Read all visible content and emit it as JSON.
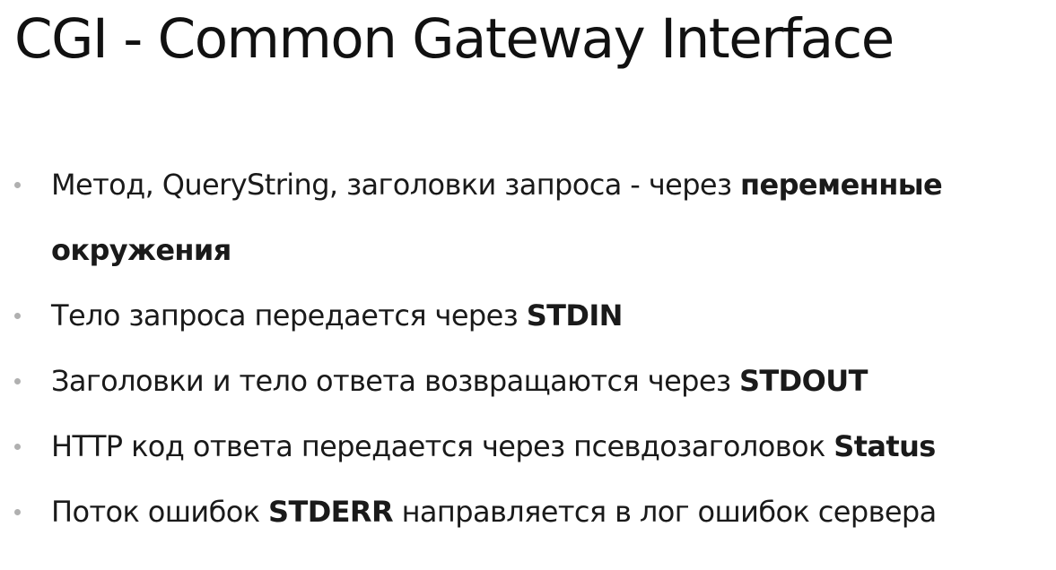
{
  "slide": {
    "title": "CGI - Common Gateway Interface",
    "bullets": [
      {
        "text": "Метод, QueryString, заголовки запроса - через ",
        "bold": "переменные",
        "continuation_bold": "окружения"
      },
      {
        "text": "Тело запроса передается через ",
        "bold": "STDIN"
      },
      {
        "text": "Заголовки и тело ответа возвращаются через ",
        "bold": "STDOUT"
      },
      {
        "text": "HTTP код ответа передается через псевдозаголовок ",
        "bold": "Status"
      },
      {
        "text_before": "Поток ошибок ",
        "bold": "STDERR",
        "text_after": " направляется в лог ошибок сервера"
      }
    ]
  }
}
